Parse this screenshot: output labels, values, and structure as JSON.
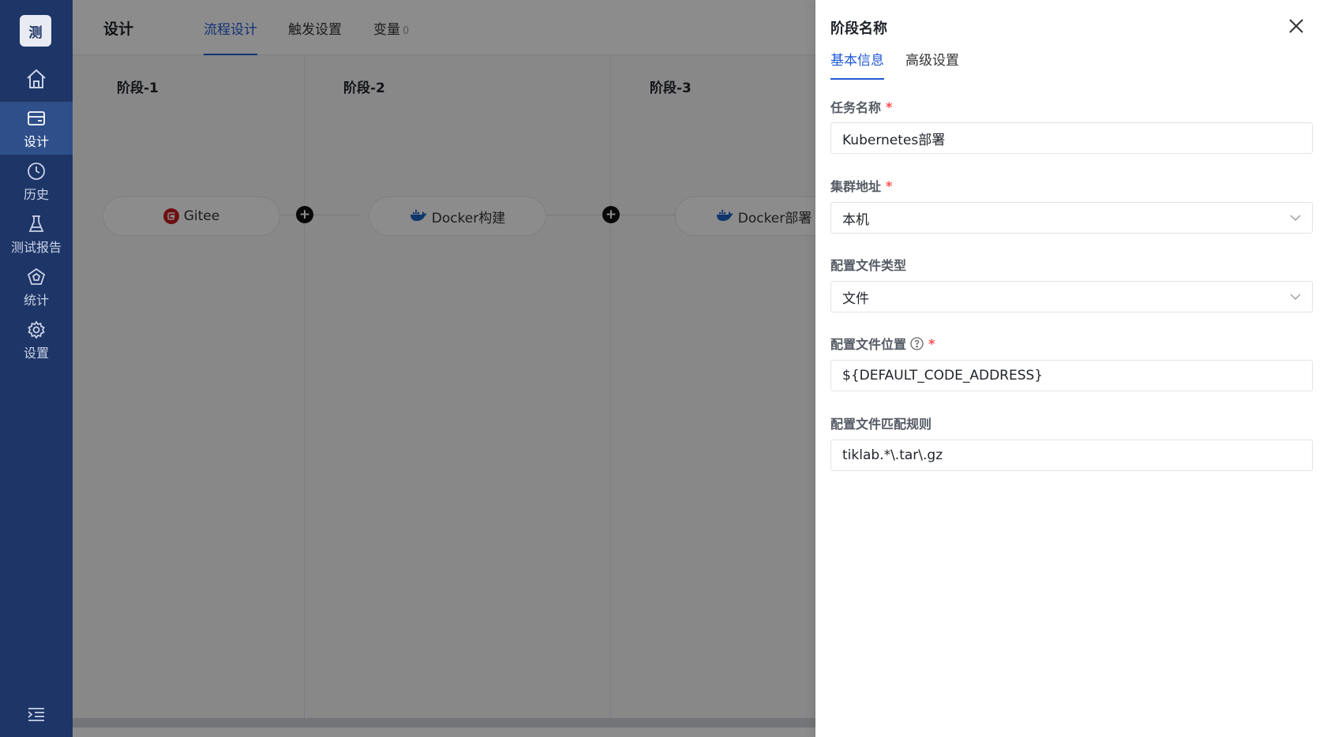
{
  "sidebar": {
    "logo_text": "测",
    "items": [
      {
        "label": "设计",
        "icon": "design-icon"
      },
      {
        "label": "历史",
        "icon": "clock-icon"
      },
      {
        "label": "测试报告",
        "icon": "flask-icon"
      },
      {
        "label": "统计",
        "icon": "chart-icon"
      },
      {
        "label": "设置",
        "icon": "gear-icon"
      }
    ],
    "active_index": 0
  },
  "header": {
    "title": "设计",
    "tabs": [
      {
        "label": "流程设计"
      },
      {
        "label": "触发设置"
      },
      {
        "label": "变量",
        "count": "0"
      }
    ],
    "active_tab": 0
  },
  "pipeline": {
    "stages": [
      {
        "title": "阶段-1",
        "task": "Gitee",
        "icon": "gitee-icon"
      },
      {
        "title": "阶段-2",
        "task": "Docker构建",
        "icon": "docker-icon"
      },
      {
        "title": "阶段-3",
        "task": "Docker部署",
        "icon": "docker-icon"
      }
    ]
  },
  "drawer": {
    "title": "阶段名称",
    "tabs": [
      {
        "label": "基本信息"
      },
      {
        "label": "高级设置"
      }
    ],
    "active_tab": 0,
    "fields": [
      {
        "label": "任务名称",
        "required": true,
        "value": "Kubernetes部署",
        "type": "input"
      },
      {
        "label": "集群地址",
        "required": true,
        "value": "本机",
        "type": "select"
      },
      {
        "label": "配置文件类型",
        "required": false,
        "value": "文件",
        "type": "select"
      },
      {
        "label": "配置文件位置",
        "required": true,
        "value": "${DEFAULT_CODE_ADDRESS}",
        "type": "input",
        "help": true
      },
      {
        "label": "配置文件匹配规则",
        "required": false,
        "value": "tiklab.*\\.tar\\.gz",
        "type": "input"
      }
    ],
    "required_mark": "*"
  },
  "colors": {
    "sidebar_bg": "#1e3567",
    "accent": "#1f59d6",
    "required": "#ff4d4f"
  }
}
